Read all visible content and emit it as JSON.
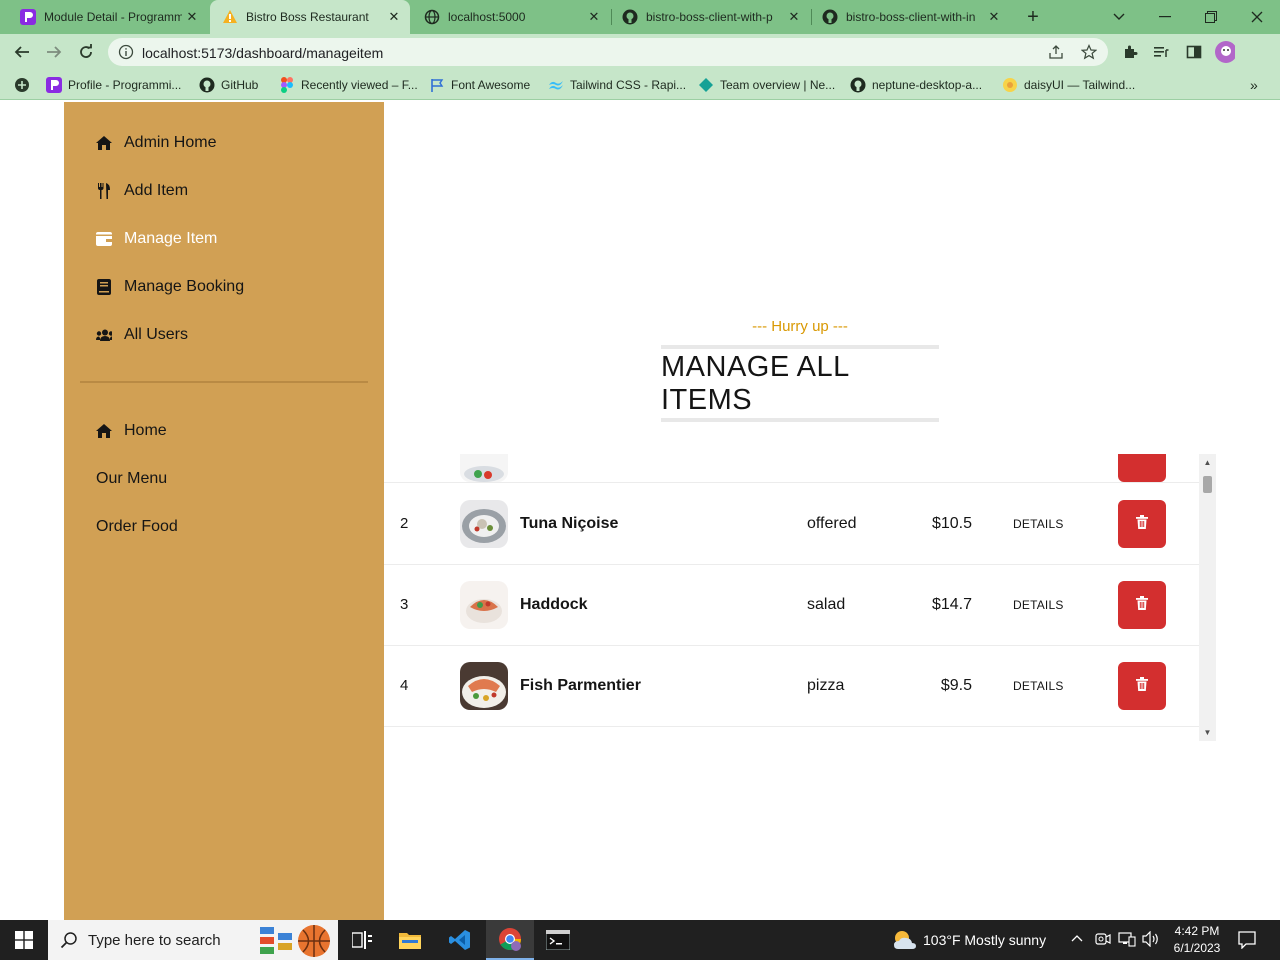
{
  "browser": {
    "tabs": [
      {
        "title": "Module Detail - Programm",
        "icon": "programming-hero-icon",
        "active": false
      },
      {
        "title": "Bistro Boss Restaurant",
        "icon": "warning-triangle-icon",
        "active": true
      },
      {
        "title": "localhost:5000",
        "icon": "globe-icon",
        "active": false
      },
      {
        "title": "bistro-boss-client-with-p",
        "icon": "github-icon",
        "active": false
      },
      {
        "title": "bistro-boss-client-with-in",
        "icon": "github-icon",
        "active": false
      }
    ],
    "url": "localhost:5173/dashboard/manageitem",
    "bookmarks": [
      {
        "label": "Profile - Programmi...",
        "icon": "programming-hero-icon"
      },
      {
        "label": "GitHub",
        "icon": "github-icon"
      },
      {
        "label": "Recently viewed – F...",
        "icon": "figma-icon"
      },
      {
        "label": "Font Awesome",
        "icon": "flag-icon"
      },
      {
        "label": "Tailwind CSS - Rapi...",
        "icon": "tailwind-icon"
      },
      {
        "label": "Team overview | Ne...",
        "icon": "diamond-icon"
      },
      {
        "label": "neptune-desktop-a...",
        "icon": "github-icon"
      },
      {
        "label": "daisyUI — Tailwind...",
        "icon": "daisyui-icon"
      }
    ]
  },
  "sidebar": {
    "top_items": [
      {
        "label": "Admin Home",
        "icon": "home-icon",
        "active": false
      },
      {
        "label": "Add Item",
        "icon": "utensils-icon",
        "active": false
      },
      {
        "label": "Manage Item",
        "icon": "wallet-icon",
        "active": true
      },
      {
        "label": "Manage Booking",
        "icon": "book-icon",
        "active": false
      },
      {
        "label": "All Users",
        "icon": "users-icon",
        "active": false
      }
    ],
    "bottom_items": [
      {
        "label": "Home",
        "icon": "home-icon"
      },
      {
        "label": "Our Menu",
        "icon": ""
      },
      {
        "label": "Order Food",
        "icon": ""
      }
    ]
  },
  "main": {
    "subtitle": "--- Hurry up ---",
    "title": "MANAGE ALL ITEMS",
    "rows": [
      {
        "num": "2",
        "name": "Tuna Niçoise",
        "category": "offered",
        "price": "$10.5",
        "action": "DETAILS"
      },
      {
        "num": "3",
        "name": "Haddock",
        "category": "salad",
        "price": "$14.7",
        "action": "DETAILS"
      },
      {
        "num": "4",
        "name": "Fish Parmentier",
        "category": "pizza",
        "price": "$9.5",
        "action": "DETAILS"
      }
    ]
  },
  "taskbar": {
    "search_placeholder": "Type here to search",
    "weather": "103°F  Mostly sunny",
    "time": "4:42 PM",
    "date": "6/1/2023"
  },
  "colors": {
    "sidebar": "#d1a054",
    "accent_gold": "#d99904",
    "delete_red": "#d32f2f",
    "tabbar": "#7ec187",
    "toolbar": "#c6e6c9"
  }
}
